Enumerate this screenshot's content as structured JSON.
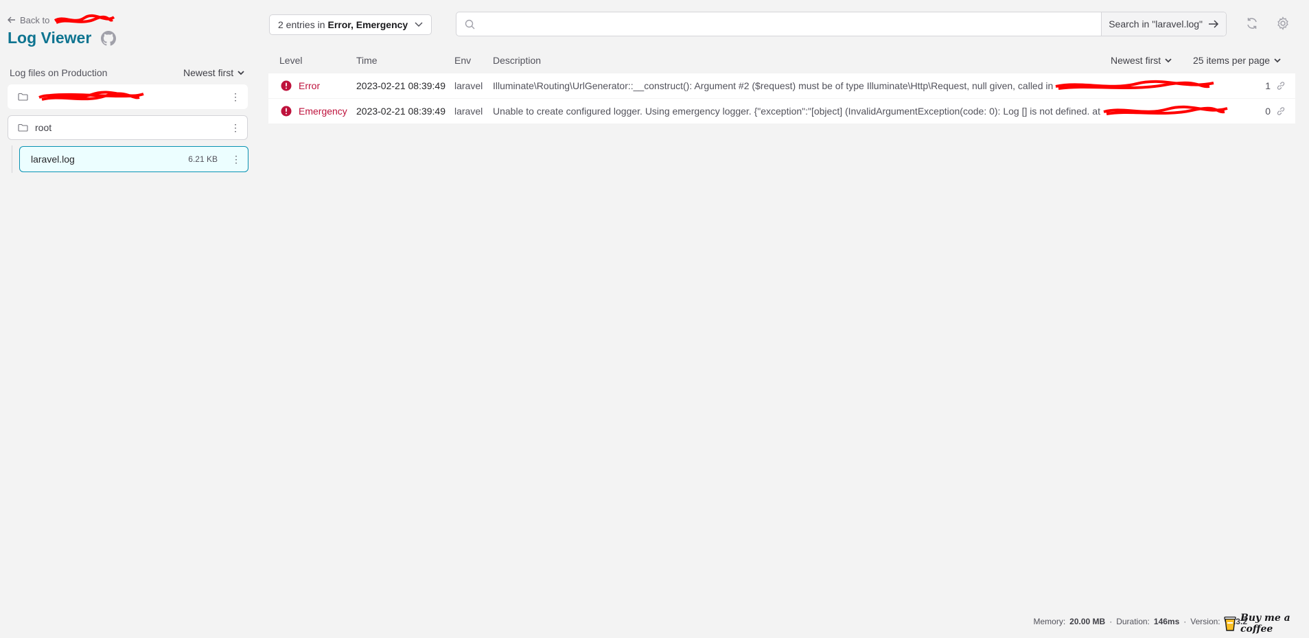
{
  "sidebar": {
    "back_label": "Back to",
    "title": "Log Viewer",
    "files_label": "Log files on Production",
    "sort_label": "Newest first",
    "folders": [
      {
        "label": ""
      },
      {
        "label": "root"
      }
    ],
    "file": {
      "name": "laravel.log",
      "size": "6.21 KB"
    }
  },
  "toolbar": {
    "filter_prefix": "2 entries in",
    "filter_levels": "Error, Emergency",
    "search_placeholder": "",
    "search_button": "Search in \"laravel.log\""
  },
  "table": {
    "headers": {
      "level": "Level",
      "time": "Time",
      "env": "Env",
      "description": "Description"
    },
    "sort_label": "Newest first",
    "per_page_label": "25 items per page",
    "rows": [
      {
        "level": "Error",
        "time": "2023-02-21 08:39:49",
        "env": "laravel",
        "description": "Illuminate\\Routing\\UrlGenerator::__construct(): Argument #2 ($request) must be of type Illuminate\\Http\\Request, null given, called in",
        "count": "1"
      },
      {
        "level": "Emergency",
        "time": "2023-02-21 08:39:49",
        "env": "laravel",
        "description": "Unable to create configured logger. Using emergency logger. {\"exception\":\"[object] (InvalidArgumentException(code: 0): Log [] is not defined. at",
        "count": "0"
      }
    ]
  },
  "footer": {
    "memory_label": "Memory:",
    "memory_value": "20.00 MB",
    "duration_label": "Duration:",
    "duration_value": "146ms",
    "version_label": "Version:",
    "version_value": "v2.3.2",
    "coffee_label": "Buy me a coffee"
  },
  "colors": {
    "accent": "#0e7490",
    "error": "#be123c",
    "background": "#f3f3f3"
  }
}
